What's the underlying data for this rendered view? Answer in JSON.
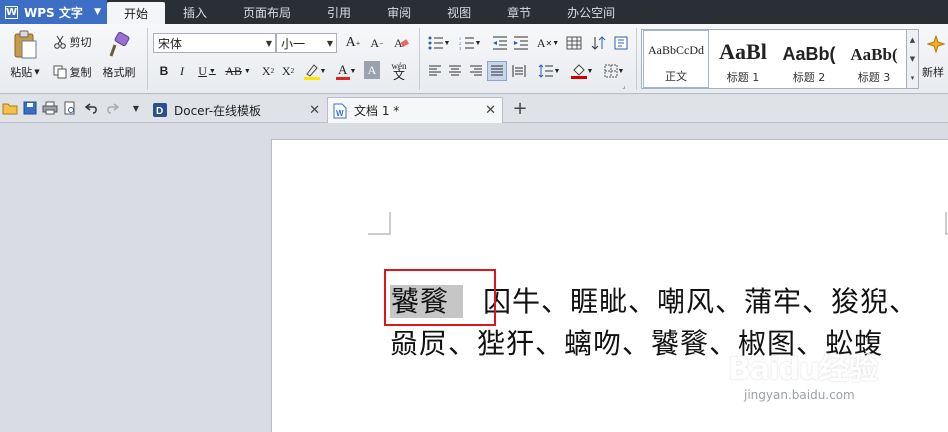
{
  "app": {
    "name": "WPS 文字",
    "logo_letter": "W"
  },
  "menu": {
    "tabs": [
      "开始",
      "插入",
      "页面布局",
      "引用",
      "审阅",
      "视图",
      "章节",
      "办公空间"
    ],
    "active_index": 0
  },
  "ribbon": {
    "paste_label": "粘贴",
    "cut_label": "剪切",
    "copy_label": "复制",
    "format_painter_label": "格式刷",
    "font_name": "宋体",
    "font_size": "小一",
    "styles": [
      {
        "preview": "AaBbCcDd",
        "label": "正文"
      },
      {
        "preview": "AaBl",
        "label": "标题 1"
      },
      {
        "preview": "AaBb(",
        "label": "标题 2"
      },
      {
        "preview": "AaBb(",
        "label": "标题 3"
      }
    ],
    "new_style_label": "新样",
    "colors": {
      "highlight": "#ffe600",
      "font_color": "#e3241b",
      "shading": "#d00000"
    }
  },
  "tabs": [
    {
      "title": "Docer-在线模板",
      "active": false
    },
    {
      "title": "文档 1 *",
      "active": true
    }
  ],
  "document": {
    "line1_selected": "饕餮",
    "line1_rest": "囚牛、睚眦、嘲风、蒲牢、狻猊、",
    "line2": "赑屃、狴犴、螭吻、饕餮、椒图、蚣蝮"
  },
  "watermark": {
    "brand": "Baidu经验",
    "url": "jingyan.baidu.com"
  }
}
